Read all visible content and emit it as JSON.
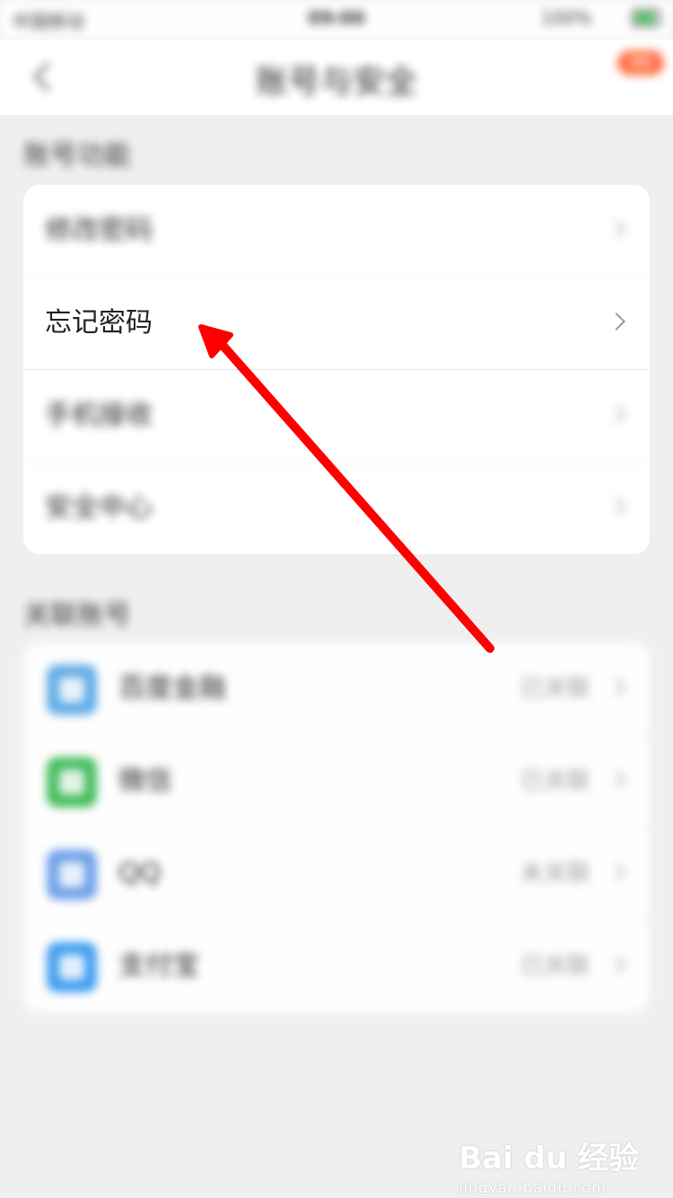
{
  "statusbar": {
    "carrier": "中国移动",
    "time": "09:00",
    "battery": "100%"
  },
  "header": {
    "title": "账号与安全",
    "badge": "99"
  },
  "account_section": {
    "title": "账号功能",
    "items": [
      {
        "label": "修改密码"
      },
      {
        "label": "忘记密码"
      },
      {
        "label": "手机接收"
      },
      {
        "label": "安全中心"
      }
    ]
  },
  "linked_section": {
    "title": "关联账号",
    "items": [
      {
        "label": "百度金融",
        "status": "已关联",
        "color": "#5aa9e6"
      },
      {
        "label": "微信",
        "status": "已关联",
        "color": "#3dbb57"
      },
      {
        "label": "QQ",
        "status": "未关联",
        "color": "#6a9ee8"
      },
      {
        "label": "支付宝",
        "status": "已关联",
        "color": "#3a9cf0"
      }
    ]
  },
  "watermark": {
    "brand": "Bai du 经验",
    "url": "jingyan.baidu.com"
  },
  "colors": {
    "accent_arrow": "#ff0000",
    "badge": "#ff6a3d"
  }
}
